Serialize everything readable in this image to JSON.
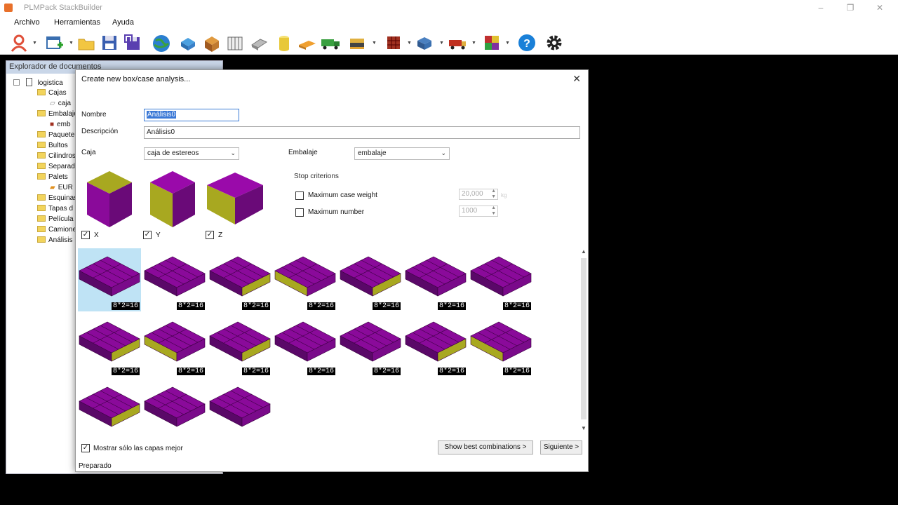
{
  "window": {
    "title": "PLMPack StackBuilder",
    "minimize": "–",
    "maximize": "❐",
    "close": "✕"
  },
  "menu": [
    "Archivo",
    "Herramientas",
    "Ayuda"
  ],
  "explorer": {
    "header": "Explorador de documentos",
    "items": [
      {
        "label": "logistica"
      },
      {
        "label": "Cajas"
      },
      {
        "label": "caja"
      },
      {
        "label": "Embalaje"
      },
      {
        "label": "emb"
      },
      {
        "label": "Paquete"
      },
      {
        "label": "Bultos"
      },
      {
        "label": "Cilindros"
      },
      {
        "label": "Separad"
      },
      {
        "label": "Palets"
      },
      {
        "label": "EUR"
      },
      {
        "label": "Esquinas"
      },
      {
        "label": "Tapas d"
      },
      {
        "label": "Película"
      },
      {
        "label": "Camione"
      },
      {
        "label": "Análisis"
      }
    ]
  },
  "dialog": {
    "title": "Create new box/case analysis...",
    "close": "✕",
    "name_label": "Nombre",
    "name_value": "Análisis0",
    "description_label": "Descripción",
    "description_value": "Análisis0",
    "box_label": "Caja",
    "box_value": "caja de estereos",
    "case_label": "Embalaje",
    "case_value": "embalaje",
    "stop_criterions": "Stop criterions",
    "max_weight_label": "Maximum case weight",
    "max_weight_value": "20,000",
    "max_weight_unit": "kg",
    "max_number_label": "Maximum number",
    "max_number_value": "1000",
    "orientations": [
      {
        "label": "X",
        "checked": true
      },
      {
        "label": "Y",
        "checked": true
      },
      {
        "label": "Z",
        "checked": true
      }
    ],
    "layouts": [
      {
        "badge": "8*2=16"
      },
      {
        "badge": "8*2=16"
      },
      {
        "badge": "8*2=16"
      },
      {
        "badge": "8*2=16"
      },
      {
        "badge": "8*2=16"
      },
      {
        "badge": "8*2=16"
      },
      {
        "badge": "8*2=16"
      },
      {
        "badge": "8*2=16"
      },
      {
        "badge": "8*2=16"
      },
      {
        "badge": "8*2=16"
      },
      {
        "badge": "8*2=16"
      },
      {
        "badge": "8*2=16"
      },
      {
        "badge": "8*2=16"
      },
      {
        "badge": "8*2=16"
      },
      {
        "badge": ""
      },
      {
        "badge": ""
      },
      {
        "badge": ""
      }
    ],
    "best_only_label": "Mostrar sólo las capas mejor",
    "show_best_button": "Show best combinations >",
    "next_button": "Siguiente >",
    "status": "Preparado"
  },
  "colors": {
    "purple": "#8a0a9a",
    "olive": "#a8a820",
    "selection": "#bfe3f5",
    "desktop": "#0d1a3a"
  }
}
